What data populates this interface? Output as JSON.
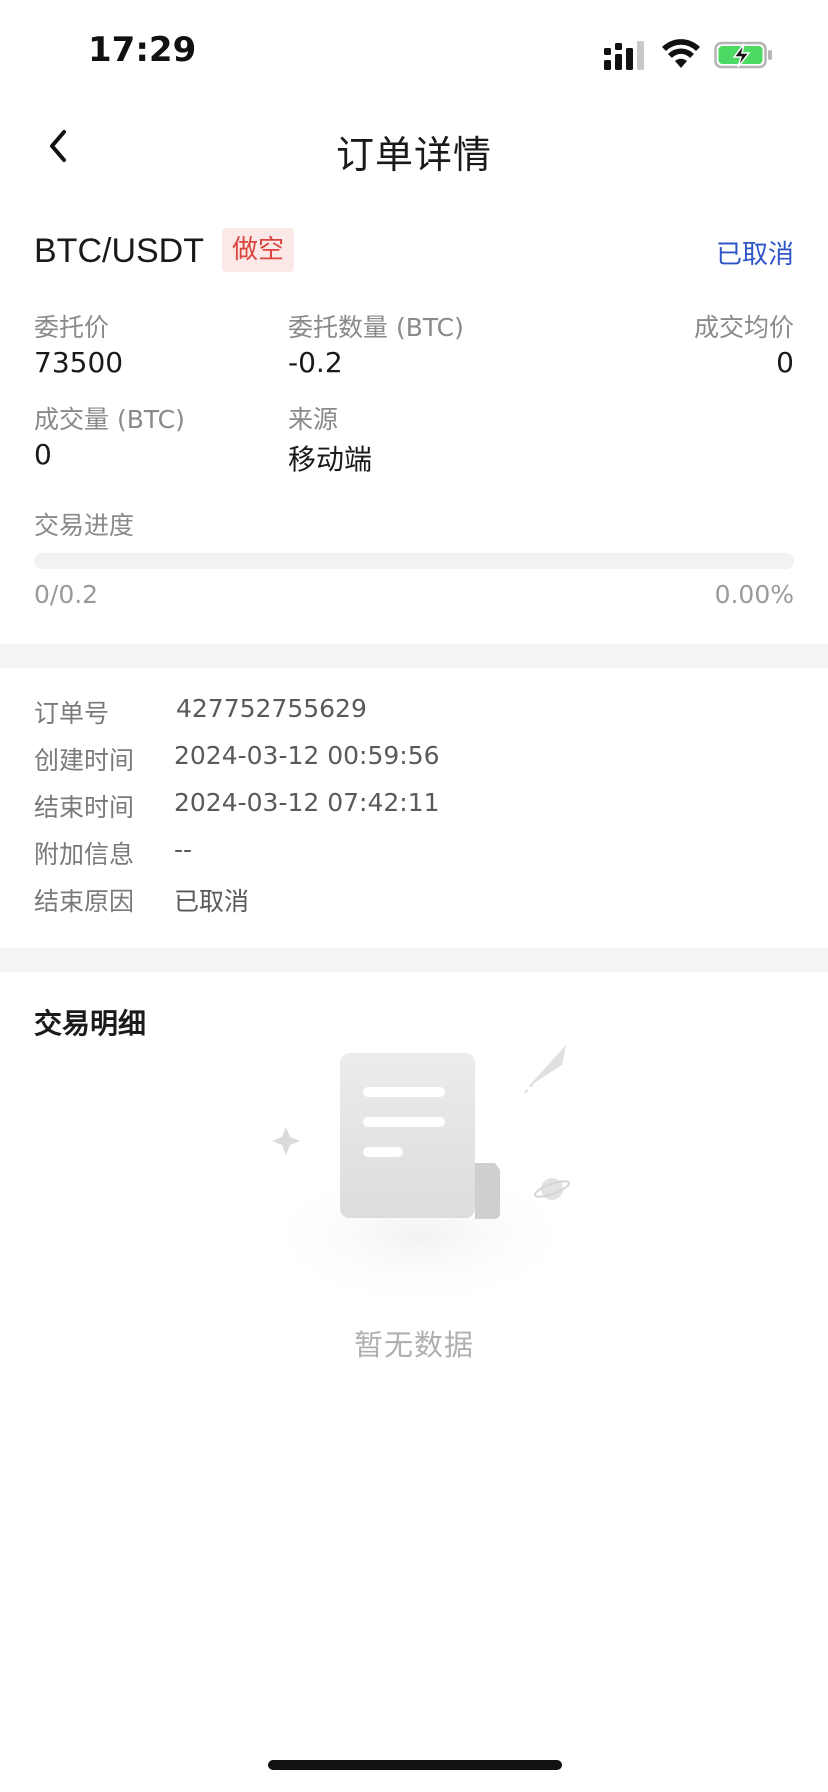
{
  "status_bar": {
    "time": "17:29"
  },
  "nav": {
    "title": "订单详情"
  },
  "order": {
    "pair": "BTC/USDT",
    "side_badge": "做空",
    "status": "已取消",
    "fields": {
      "order_price_label": "委托价",
      "order_price_value": "73500",
      "order_qty_label": "委托数量 (BTC)",
      "order_qty_value": "-0.2",
      "avg_price_label": "成交均价",
      "avg_price_value": "0",
      "filled_qty_label": "成交量 (BTC)",
      "filled_qty_value": "0",
      "source_label": "来源",
      "source_value": "移动端"
    },
    "progress": {
      "label": "交易进度",
      "amount_text": "0/0.2",
      "percent_text": "0.00%",
      "fraction": 0
    }
  },
  "info": {
    "rows": [
      {
        "label": "订单号",
        "value": "427752755629"
      },
      {
        "label": "创建时间",
        "value": "2024-03-12 00:59:56"
      },
      {
        "label": "结束时间",
        "value": "2024-03-12 07:42:11"
      },
      {
        "label": "附加信息",
        "value": "--"
      },
      {
        "label": "结束原因",
        "value": "已取消"
      }
    ]
  },
  "details": {
    "title": "交易明细",
    "empty_text": "暂无数据"
  },
  "colors": {
    "accent_blue": "#2f56c7",
    "short_red": "#d9463f",
    "badge_bg": "#fde8e8"
  },
  "icons": {
    "back": "chevron-left-icon",
    "signal": "cellular-signal-icon",
    "wifi": "wifi-icon",
    "battery": "battery-charging-icon",
    "empty": "empty-document-icon"
  }
}
